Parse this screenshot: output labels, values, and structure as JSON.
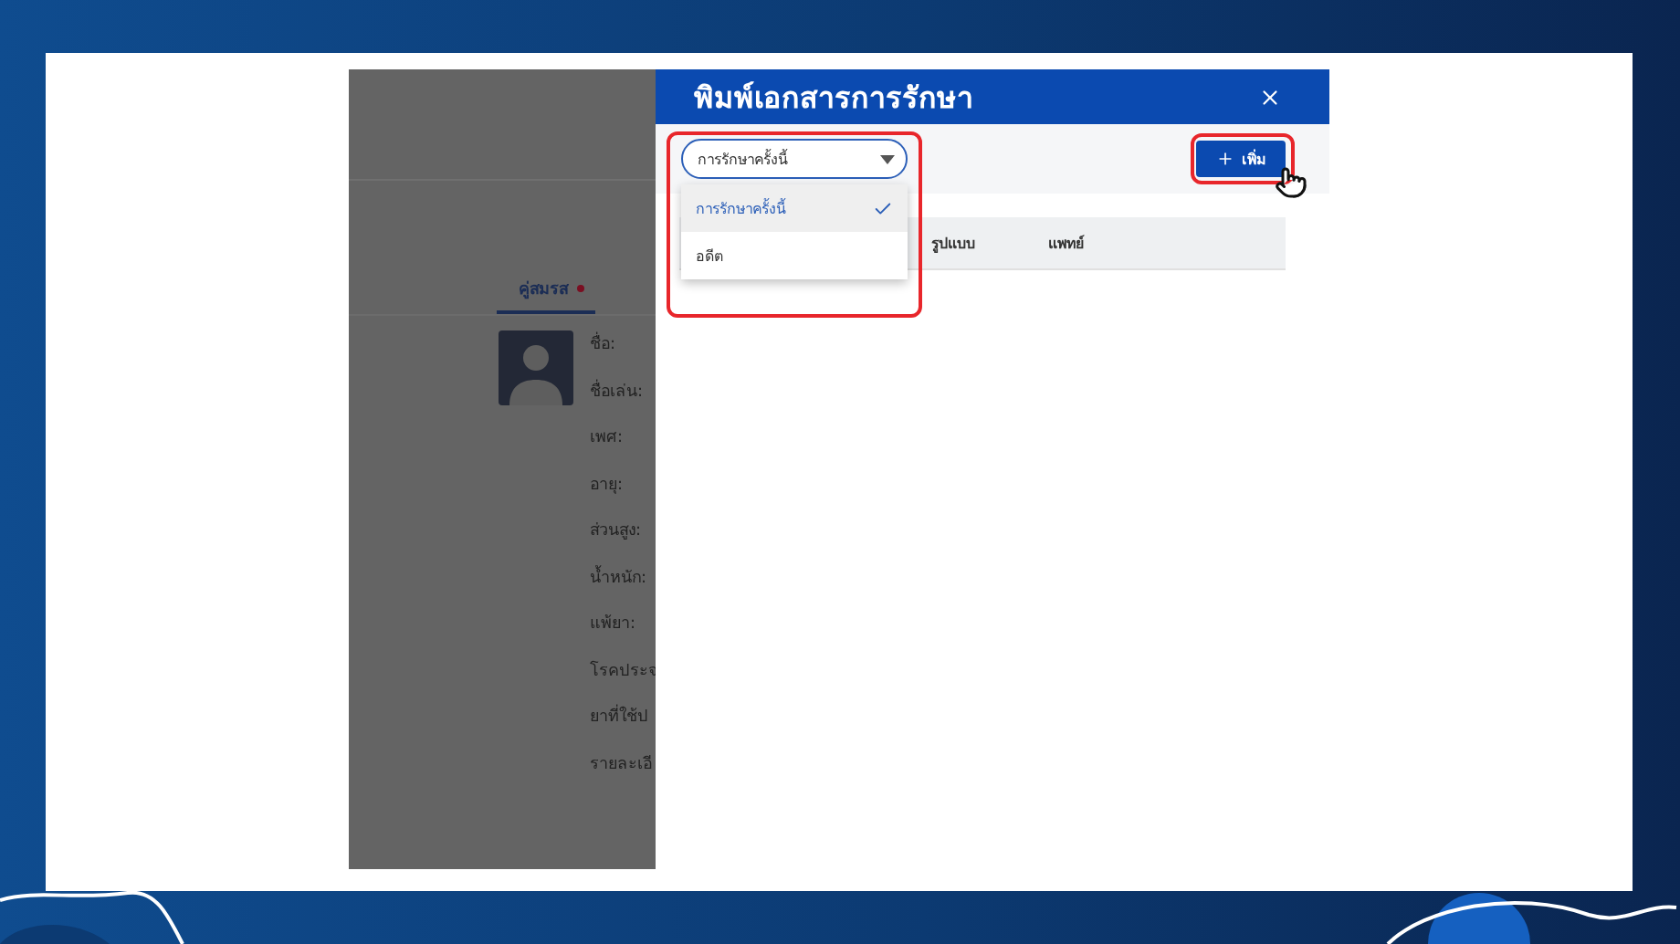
{
  "background_page": {
    "tabs": [
      {
        "label": "คู่สมรส",
        "selected": true
      }
    ],
    "profile_fields": [
      "ชื่อ:",
      "ชื่อเล่น:",
      "เพศ:",
      "อายุ:",
      "ส่วนสูง:",
      "น้ำหนัก:",
      "แพ้ยา:",
      "โรคประจ",
      "ยาที่ใช้ป",
      "รายละเอี"
    ]
  },
  "dialog": {
    "title": "พิมพ์เอกสารการรักษา",
    "filter": {
      "value": "การรักษาครั้งนี้",
      "expanded": true,
      "options": [
        {
          "label": "การรักษาครั้งนี้",
          "selected": true
        },
        {
          "label": "อดีต",
          "selected": false
        }
      ]
    },
    "add_button": {
      "label": "เพิ่ม"
    },
    "table": {
      "columns": [
        "รูปแบบ",
        "แพทย์"
      ]
    }
  }
}
